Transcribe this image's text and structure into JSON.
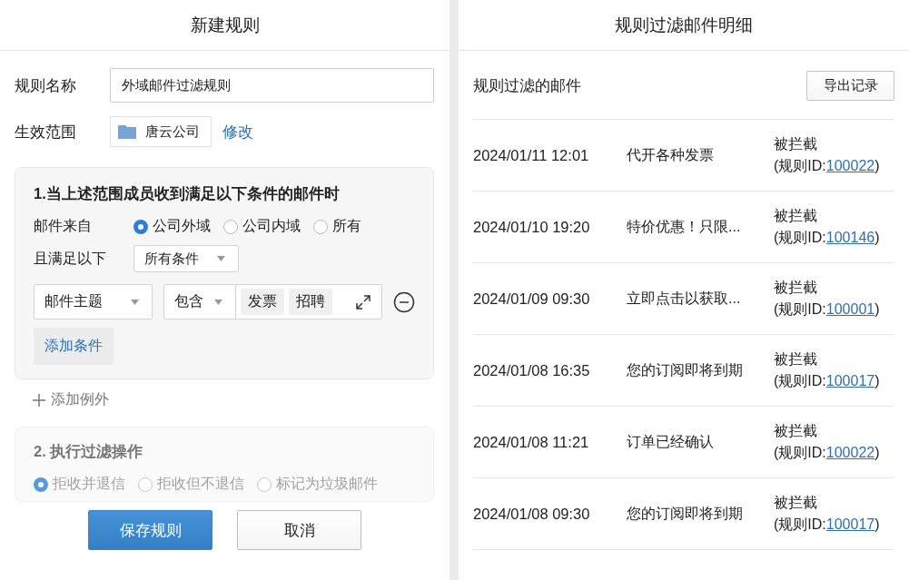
{
  "rule_editor": {
    "title": "新建规则",
    "name_field": {
      "label": "规则名称",
      "value": "外域邮件过滤规则"
    },
    "scope": {
      "label": "生效范围",
      "value": "唐云公司",
      "edit_link": "修改"
    },
    "condition_section": {
      "title": "1.当上述范围成员收到满足以下条件的邮件时",
      "source": {
        "label": "邮件来自",
        "options": [
          {
            "label": "公司外域",
            "selected": true
          },
          {
            "label": "公司内域",
            "selected": false
          },
          {
            "label": "所有",
            "selected": false
          }
        ]
      },
      "match": {
        "label": "且满足以下",
        "value": "所有条件"
      },
      "conditions": [
        {
          "field": "邮件主题",
          "operator": "包含",
          "tags": [
            "发票",
            "招聘"
          ]
        }
      ],
      "add_condition": "添加条件"
    },
    "add_exception": "添加例外",
    "action_section": {
      "title": "2. 执行过滤操作",
      "options": [
        {
          "label": "拒收并退信",
          "selected": true
        },
        {
          "label": "拒收但不退信",
          "selected": false
        },
        {
          "label": "标记为垃圾邮件",
          "selected": false
        }
      ]
    },
    "buttons": [
      {
        "label": "保存规则",
        "kind": "primary"
      },
      {
        "label": "取消",
        "kind": "secondary"
      }
    ]
  },
  "filtered_mail": {
    "title": "规则过滤邮件明细",
    "subtitle": "规则过滤的邮件",
    "export_button": "导出记录",
    "rows": [
      {
        "time": "2024/01/11 12:01",
        "subject": "代开各种发票",
        "status": "被拦截",
        "rule_prefix": "(规则ID:",
        "rule_id": "100022",
        "rule_suffix": ")"
      },
      {
        "time": "2024/01/10 19:20",
        "subject": "特价优惠！只限...",
        "status": "被拦截",
        "rule_prefix": "(规则ID:",
        "rule_id": "100146",
        "rule_suffix": ")"
      },
      {
        "time": "2024/01/09 09:30",
        "subject": "立即点击以获取...",
        "status": "被拦截",
        "rule_prefix": "(规则ID:",
        "rule_id": "100001",
        "rule_suffix": ")"
      },
      {
        "time": "2024/01/08 16:35",
        "subject": "您的订阅即将到期",
        "status": "被拦截",
        "rule_prefix": "(规则ID:",
        "rule_id": "100017",
        "rule_suffix": ")"
      },
      {
        "time": "2024/01/08 11:21",
        "subject": "订单已经确认",
        "status": "被拦截",
        "rule_prefix": "(规则ID:",
        "rule_id": "100022",
        "rule_suffix": ")"
      },
      {
        "time": "2024/01/08 09:30",
        "subject": "您的订阅即将到期",
        "status": "被拦截",
        "rule_prefix": "(规则ID:",
        "rule_id": "100017",
        "rule_suffix": ")"
      }
    ]
  }
}
